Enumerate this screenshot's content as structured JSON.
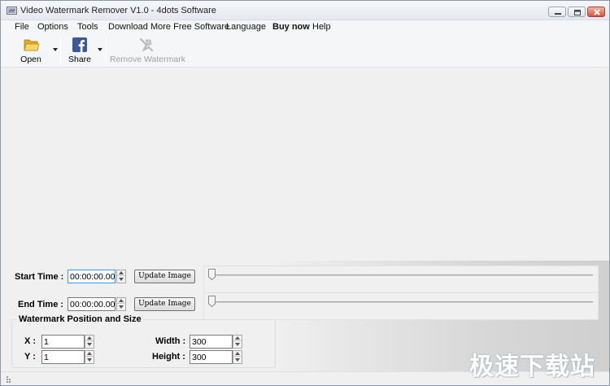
{
  "window": {
    "title": "Video Watermark Remover V1.0 - 4dots Software",
    "controls": {
      "minimize": "minimize-icon",
      "maximize": "maximize-icon",
      "close": "close-icon"
    }
  },
  "menu": {
    "items": [
      {
        "label": "File"
      },
      {
        "label": "Options"
      },
      {
        "label": "Tools"
      },
      {
        "label": "Download More Free Software"
      },
      {
        "label": "Language"
      },
      {
        "label": "Buy now",
        "bold": true
      },
      {
        "label": "Help"
      }
    ]
  },
  "toolbar": {
    "open": {
      "label": "Open",
      "icon": "folder-icon"
    },
    "share": {
      "label": "Share",
      "icon": "facebook-icon"
    },
    "remove": {
      "label": "Remove Watermark",
      "icon": "remove-watermark-icon",
      "enabled": false
    }
  },
  "timing": {
    "start_label": "Start Time :",
    "start_value": "00:00:00.00",
    "end_label": "End Time :",
    "end_value": "00:00:00.00",
    "update_label": "Update Image",
    "start_slider": 0,
    "end_slider": 0
  },
  "position": {
    "group_title": "Watermark Position and Size",
    "x_label": "X :",
    "x_value": "1",
    "y_label": "Y :",
    "y_value": "1",
    "width_label": "Width :",
    "width_value": "300",
    "height_label": "Height :",
    "height_value": "300"
  },
  "overlay_watermark": "极速下载站",
  "colors": {
    "accent_focus": "#3399ff",
    "facebook": "#3b5998",
    "folder": "#f3c33f"
  }
}
